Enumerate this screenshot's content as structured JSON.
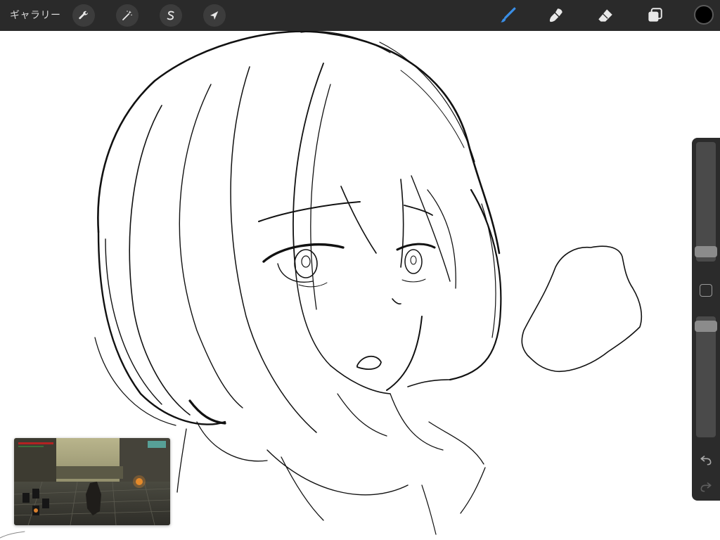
{
  "toolbar": {
    "gallery_label": "ギャラリー",
    "left_tools": [
      {
        "name": "actions",
        "icon": "wrench-icon"
      },
      {
        "name": "adjustments",
        "icon": "magic-wand-icon"
      },
      {
        "name": "selection",
        "icon": "selection-s-icon"
      },
      {
        "name": "transform",
        "icon": "arrow-cursor-icon"
      }
    ],
    "right_tools": [
      {
        "name": "brush",
        "icon": "brush-icon",
        "active": true
      },
      {
        "name": "smudge",
        "icon": "smudge-icon"
      },
      {
        "name": "eraser",
        "icon": "eraser-icon"
      },
      {
        "name": "layers",
        "icon": "layers-icon"
      }
    ],
    "current_color": "#000000",
    "active_color": "#3a8ee6"
  },
  "sidebar": {
    "brush_size_level": 0.05,
    "opacity_level": 0.97,
    "buttons": [
      "modify-square-icon",
      "undo-icon",
      "redo-icon"
    ]
  },
  "overlay": {
    "description_icon": "game-video-thumbnail"
  }
}
